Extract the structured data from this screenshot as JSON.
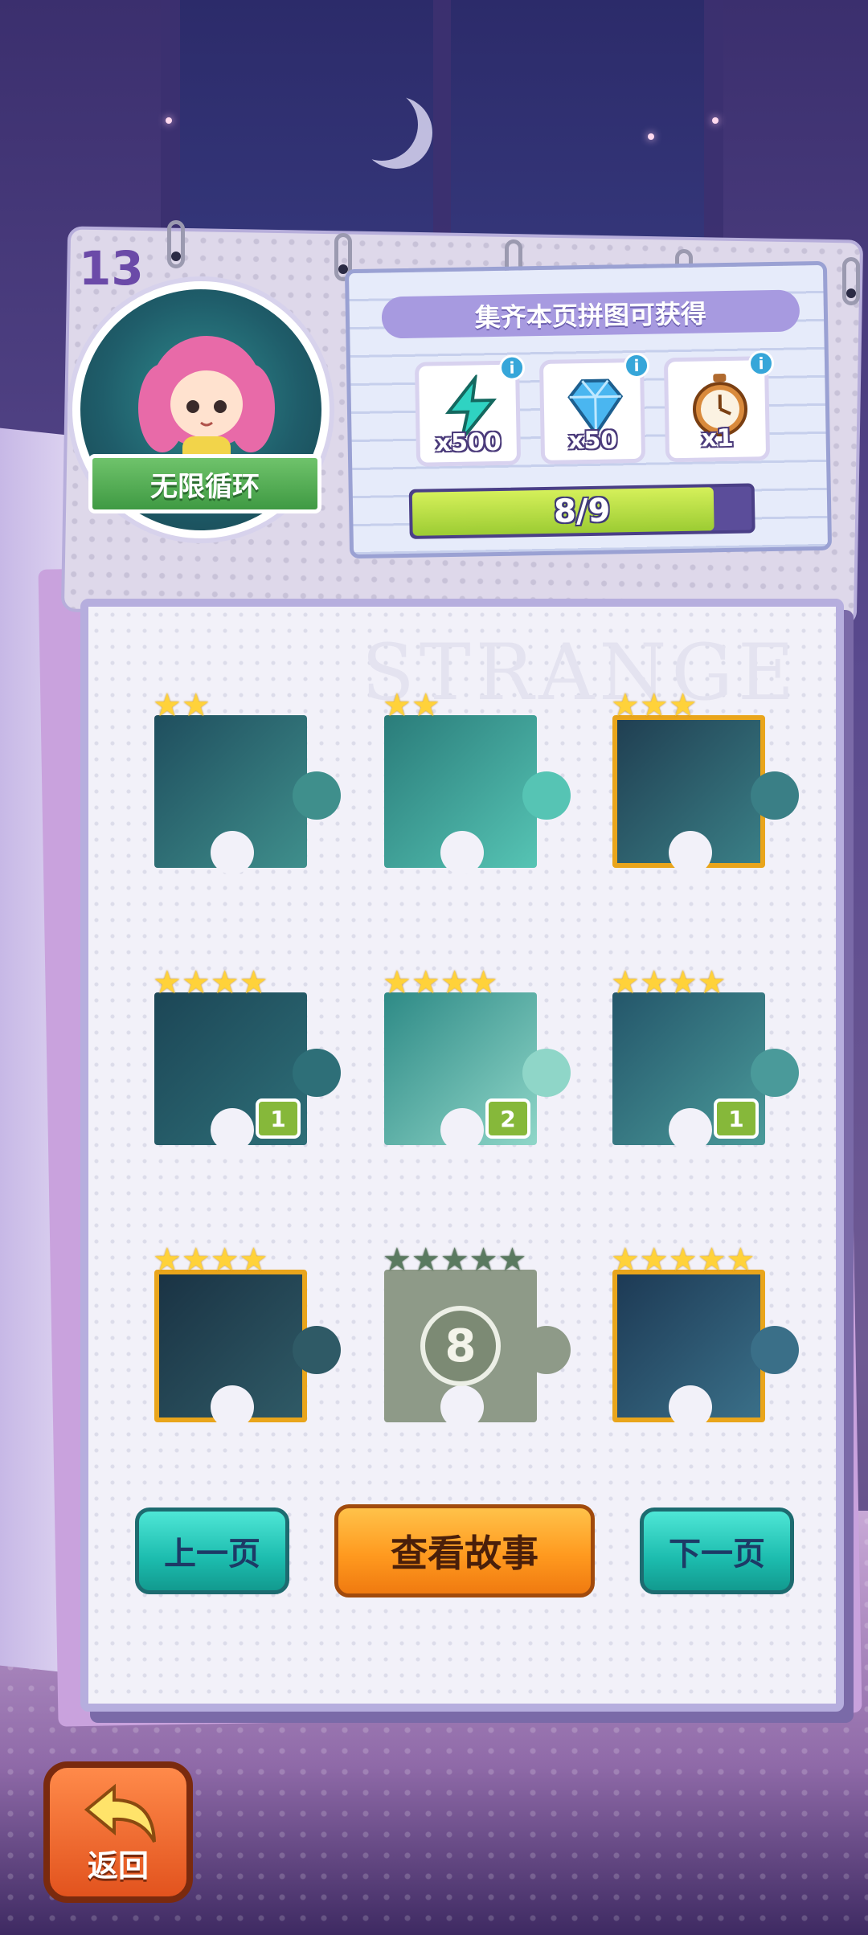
{
  "chapter": {
    "page_number": "13",
    "badge_label": "无限循环"
  },
  "reward": {
    "title": "集齐本页拼图可获得",
    "items": [
      {
        "icon": "lightning-icon",
        "count": "x500"
      },
      {
        "icon": "diamond-icon",
        "count": "x50"
      },
      {
        "icon": "stopwatch-icon",
        "count": "x1"
      }
    ],
    "info_symbol": "i",
    "progress_text": "8/9",
    "progress_fraction": 0.889,
    "colors": {
      "progress": "#a6d23a",
      "panel": "#e6ebfa"
    }
  },
  "sheet": {
    "watermark": "STRANGE"
  },
  "pieces": [
    {
      "stars": 2,
      "count": ""
    },
    {
      "stars": 2,
      "count": ""
    },
    {
      "stars": 3,
      "count": ""
    },
    {
      "stars": 4,
      "count": "1"
    },
    {
      "stars": 4,
      "count": "2"
    },
    {
      "stars": 4,
      "count": "1"
    },
    {
      "stars": 4,
      "count": ""
    },
    {
      "stars": 5,
      "locked_number": "8"
    },
    {
      "stars": 5,
      "count": ""
    }
  ],
  "buttons": {
    "prev": "上一页",
    "story": "查看故事",
    "next": "下一页"
  },
  "back": {
    "label": "返回"
  }
}
